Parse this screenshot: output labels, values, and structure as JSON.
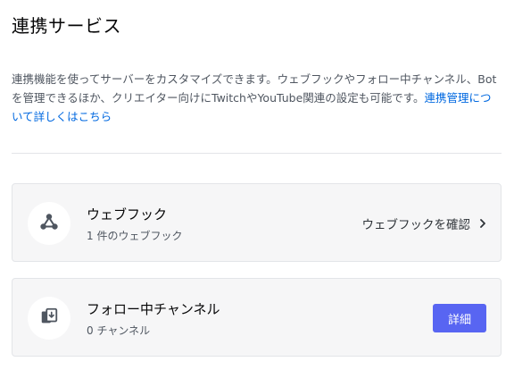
{
  "page": {
    "title": "連携サービス",
    "description": "連携機能を使ってサーバーをカスタマイズできます。ウェブフックやフォロー中チャンネル、Botを管理できるほか、クリエイター向けにTwitchやYouTube関連の設定も可能です。",
    "learn_more_link": "連携管理について詳しくはこちら"
  },
  "cards": {
    "webhooks": {
      "title": "ウェブフック",
      "subtitle": "1 件のウェブフック",
      "action_label": "ウェブフックを確認",
      "icon": "webhook-icon"
    },
    "followed_channels": {
      "title": "フォロー中チャンネル",
      "subtitle": "0 チャンネル",
      "action_label": "詳細",
      "icon": "followed-channel-icon"
    }
  },
  "colors": {
    "accent": "#5865f2",
    "link": "#0068e0",
    "card_bg": "#f6f6f7"
  }
}
